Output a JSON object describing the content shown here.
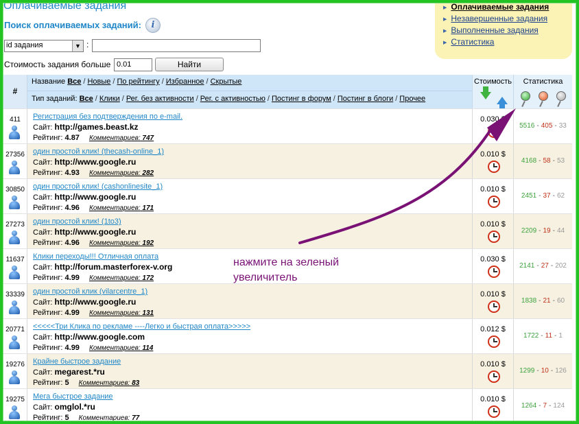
{
  "page_title": "Оплачиваемые задания",
  "search": {
    "label": "Поиск оплачиваемых заданий:",
    "select_value": "id задания",
    "colon": ":",
    "input_value": ""
  },
  "cost_filter": {
    "label": "Стоимость задания больше",
    "value": "0.01",
    "button": "Найти"
  },
  "nav": {
    "items": [
      {
        "label": "Оплачиваемые задания"
      },
      {
        "label": "Незавершенные задания"
      },
      {
        "label": "Выполненные задания"
      },
      {
        "label": "Статистика"
      }
    ]
  },
  "header": {
    "num": "#",
    "name_prefix": "Название",
    "name_filters": [
      "Все",
      "Новые",
      "По рейтингу",
      "Избранное",
      "Скрытые"
    ],
    "type_prefix": "Тип заданий:",
    "type_filters": [
      "Все",
      "Клики",
      "Рег. без активности",
      "Рег. с активностью",
      "Постинг в форум",
      "Постинг в блоги",
      "Прочее"
    ],
    "cost": "Стоимость",
    "stat": "Статистика"
  },
  "labels": {
    "site": "Сайт:",
    "rating": "Рейтинг:",
    "comments": "Комментариев:",
    "dash": "-"
  },
  "rows": [
    {
      "id": "411",
      "title": "Регистрация без подтверждения по e-mail.",
      "site": "http://games.beast.kz",
      "rating": "4.87",
      "comments": "747",
      "cost": "0.030 $",
      "s1": "5516",
      "s2": "405",
      "s3": "33"
    },
    {
      "id": "27356",
      "title": "один простой клик! (thecash-online_1)",
      "site": "http://www.google.ru",
      "rating": "4.93",
      "comments": "282",
      "cost": "0.010 $",
      "s1": "4168",
      "s2": "58",
      "s3": "53"
    },
    {
      "id": "30850",
      "title": "один простой клик! (cashonlinesite_1)",
      "site": "http://www.google.ru",
      "rating": "4.96",
      "comments": "171",
      "cost": "0.010 $",
      "s1": "2451",
      "s2": "37",
      "s3": "62"
    },
    {
      "id": "27273",
      "title": "один простой клик! (1to3)",
      "site": "http://www.google.ru",
      "rating": "4.96",
      "comments": "192",
      "cost": "0.010 $",
      "s1": "2209",
      "s2": "19",
      "s3": "44"
    },
    {
      "id": "11637",
      "title": "Клики переходы!!! Отличная оплата",
      "site": "http://forum.masterforex-v.org",
      "rating": "4.99",
      "comments": "172",
      "cost": "0.030 $",
      "s1": "2141",
      "s2": "27",
      "s3": "202"
    },
    {
      "id": "33339",
      "title": "один простой клик (vilarcentre_1)",
      "site": "http://www.google.ru",
      "rating": "4.99",
      "comments": "131",
      "cost": "0.010 $",
      "s1": "1838",
      "s2": "21",
      "s3": "60"
    },
    {
      "id": "20771",
      "title": "<<<<<Три Клика по рекламе ----Легко и быстрая оплата>>>>>",
      "site": "http://www.google.com",
      "rating": "4.99",
      "comments": "114",
      "cost": "0.012 $",
      "s1": "1722",
      "s2": "11",
      "s3": "1"
    },
    {
      "id": "19276",
      "title": "Крайне быстрое задание",
      "site": "megarest.*ru",
      "rating": "5",
      "comments": "83",
      "cost": "0.010 $",
      "s1": "1299",
      "s2": "10",
      "s3": "126"
    },
    {
      "id": "19275",
      "title": "Мега быстрое задание",
      "site": "omglol.*ru",
      "rating": "5",
      "comments": "77",
      "cost": "0.010 $",
      "s1": "1264",
      "s2": "7",
      "s3": "124"
    }
  ],
  "annotation": {
    "line1": "нажмите на зеленый",
    "line2": "увеличитель"
  },
  "colors": {
    "accent": "#1f86c8",
    "frame": "#22c322",
    "annotation": "#7a1276"
  }
}
